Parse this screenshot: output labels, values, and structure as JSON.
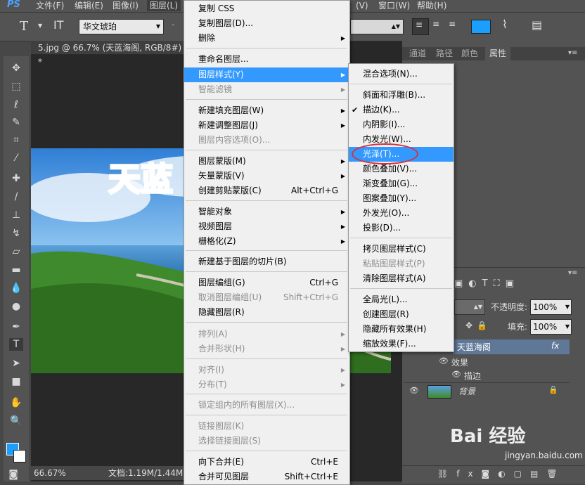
{
  "menubar": {
    "logo": "PS",
    "items": [
      "文件(F)",
      "编辑(E)",
      "图像(I)",
      "图层(L)",
      "(V)",
      "窗口(W)",
      "帮助(H)"
    ]
  },
  "options": {
    "tool_letter": "T",
    "font_family": "华文琥珀",
    "dash": "-"
  },
  "document": {
    "tab_title": "5.jpg @ 66.7% (天蓝海阁, RGB/8#) *",
    "tab_close": "×",
    "zoom": "66.67%",
    "doc_info": "文档:1.19M/1.44M",
    "image_text": "天蓝"
  },
  "right_tabs": [
    "通道",
    "路径",
    "颜色",
    "属性"
  ],
  "layers": {
    "opacity_label": "不透明度:",
    "opacity_value": "100%",
    "fill_label": "填充:",
    "fill_value": "100%",
    "layer1_name": "天蓝海阁",
    "layer1_fx": "fx",
    "effects_label": "效果",
    "stroke_label": "描边",
    "bg_name": "背景"
  },
  "menu1": [
    {
      "label": "复制 CSS",
      "shortcut": "",
      "submenu": false,
      "disabled": false
    },
    {
      "label": "复制图层(D)...",
      "shortcut": "",
      "submenu": false,
      "disabled": false
    },
    {
      "label": "删除",
      "shortcut": "",
      "submenu": true,
      "disabled": false
    },
    {
      "label": "重命名图层...",
      "shortcut": "",
      "submenu": false,
      "disabled": false
    },
    {
      "label": "图层样式(Y)",
      "shortcut": "",
      "submenu": true,
      "disabled": false,
      "highlight": true
    },
    {
      "label": "智能滤镜",
      "shortcut": "",
      "submenu": true,
      "disabled": true
    },
    {
      "label": "新建填充图层(W)",
      "shortcut": "",
      "submenu": true,
      "disabled": false
    },
    {
      "label": "新建调整图层(J)",
      "shortcut": "",
      "submenu": true,
      "disabled": false
    },
    {
      "label": "图层内容选项(O)...",
      "shortcut": "",
      "submenu": false,
      "disabled": true
    },
    {
      "label": "图层蒙版(M)",
      "shortcut": "",
      "submenu": true,
      "disabled": false
    },
    {
      "label": "矢量蒙版(V)",
      "shortcut": "",
      "submenu": true,
      "disabled": false
    },
    {
      "label": "创建剪贴蒙版(C)",
      "shortcut": "Alt+Ctrl+G",
      "submenu": false,
      "disabled": false
    },
    {
      "label": "智能对象",
      "shortcut": "",
      "submenu": true,
      "disabled": false
    },
    {
      "label": "视频图层",
      "shortcut": "",
      "submenu": true,
      "disabled": false
    },
    {
      "label": "栅格化(Z)",
      "shortcut": "",
      "submenu": true,
      "disabled": false
    },
    {
      "label": "新建基于图层的切片(B)",
      "shortcut": "",
      "submenu": false,
      "disabled": false
    },
    {
      "label": "图层编组(G)",
      "shortcut": "Ctrl+G",
      "submenu": false,
      "disabled": false
    },
    {
      "label": "取消图层编组(U)",
      "shortcut": "Shift+Ctrl+G",
      "submenu": false,
      "disabled": true
    },
    {
      "label": "隐藏图层(R)",
      "shortcut": "",
      "submenu": false,
      "disabled": false
    },
    {
      "label": "排列(A)",
      "shortcut": "",
      "submenu": true,
      "disabled": true
    },
    {
      "label": "合并形状(H)",
      "shortcut": "",
      "submenu": true,
      "disabled": true
    },
    {
      "label": "对齐(I)",
      "shortcut": "",
      "submenu": true,
      "disabled": true
    },
    {
      "label": "分布(T)",
      "shortcut": "",
      "submenu": true,
      "disabled": true
    },
    {
      "label": "锁定组内的所有图层(X)...",
      "shortcut": "",
      "submenu": false,
      "disabled": true
    },
    {
      "label": "链接图层(K)",
      "shortcut": "",
      "submenu": false,
      "disabled": true
    },
    {
      "label": "选择链接图层(S)",
      "shortcut": "",
      "submenu": false,
      "disabled": true
    },
    {
      "label": "向下合并(E)",
      "shortcut": "Ctrl+E",
      "submenu": false,
      "disabled": false
    },
    {
      "label": "合并可见图层",
      "shortcut": "Shift+Ctrl+E",
      "submenu": false,
      "disabled": false
    }
  ],
  "menu2": [
    {
      "label": "混合选项(N)...",
      "disabled": false
    },
    {
      "label": "斜面和浮雕(B)...",
      "disabled": false
    },
    {
      "label": "描边(K)...",
      "disabled": false,
      "checked": true
    },
    {
      "label": "内阴影(I)...",
      "disabled": false
    },
    {
      "label": "内发光(W)...",
      "disabled": false
    },
    {
      "label": "光泽(T)...",
      "disabled": false,
      "highlight": true
    },
    {
      "label": "颜色叠加(V)...",
      "disabled": false
    },
    {
      "label": "渐变叠加(G)...",
      "disabled": false
    },
    {
      "label": "图案叠加(Y)...",
      "disabled": false
    },
    {
      "label": "外发光(O)...",
      "disabled": false
    },
    {
      "label": "投影(D)...",
      "disabled": false
    },
    {
      "label": "拷贝图层样式(C)",
      "disabled": false
    },
    {
      "label": "粘贴图层样式(P)",
      "disabled": true
    },
    {
      "label": "清除图层样式(A)",
      "disabled": false
    },
    {
      "label": "全局光(L)...",
      "disabled": false
    },
    {
      "label": "创建图层(R)",
      "disabled": false
    },
    {
      "label": "隐藏所有效果(H)",
      "disabled": false
    },
    {
      "label": "缩放效果(F)...",
      "disabled": false
    }
  ],
  "watermark": {
    "brand": "Bai 经验",
    "url": "jingyan.baidu.com"
  },
  "colors": {
    "highlight": "#3399ff",
    "accent_swatch": "#1a9fff",
    "circle": "#d9303a"
  }
}
